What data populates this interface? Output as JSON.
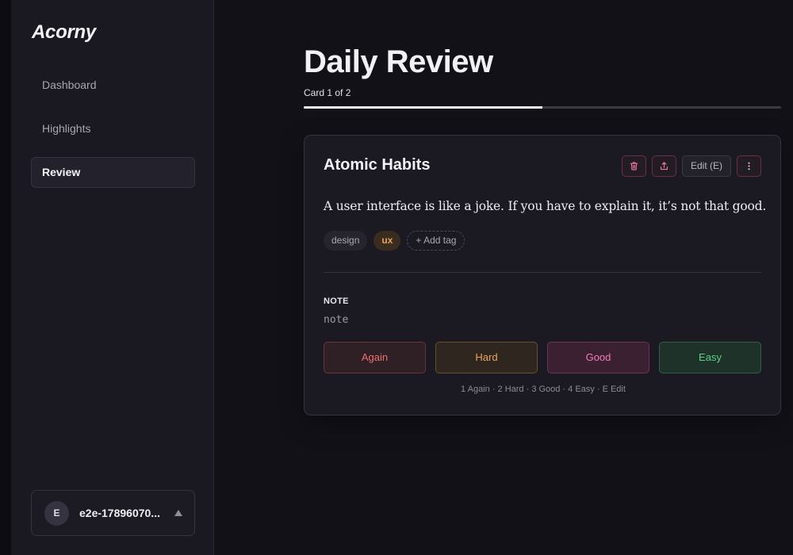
{
  "app": {
    "logo": "Acorny"
  },
  "sidebar": {
    "items": [
      {
        "label": "Dashboard",
        "active": false
      },
      {
        "label": "Highlights",
        "active": false
      },
      {
        "label": "Review",
        "active": true
      }
    ],
    "user": {
      "initial": "E",
      "name": "e2e-17896070..."
    }
  },
  "main": {
    "title": "Daily Review",
    "progress_label": "Card 1 of 2",
    "progress_fraction": 0.5
  },
  "card": {
    "title": "Atomic Habits",
    "edit_label": "Edit (E)",
    "quote": "A user interface is like a joke. If you have to explain it, it’s not that good.",
    "tags": [
      "design",
      "ux"
    ],
    "add_tag_label": "+ Add tag",
    "note_label": "NOTE",
    "note_text": "note",
    "ratings": {
      "again": "Again",
      "hard": "Hard",
      "good": "Good",
      "easy": "Easy"
    },
    "shortcuts_hint": "1 Again · 2 Hard · 3 Good · 4 Easy · E Edit"
  },
  "colors": {
    "accent_danger": "#ef6f6f",
    "accent_hard": "#eea458",
    "accent_good": "#f07cb8",
    "accent_easy": "#5fcf8c",
    "tag_ux": "#e5a35a"
  }
}
